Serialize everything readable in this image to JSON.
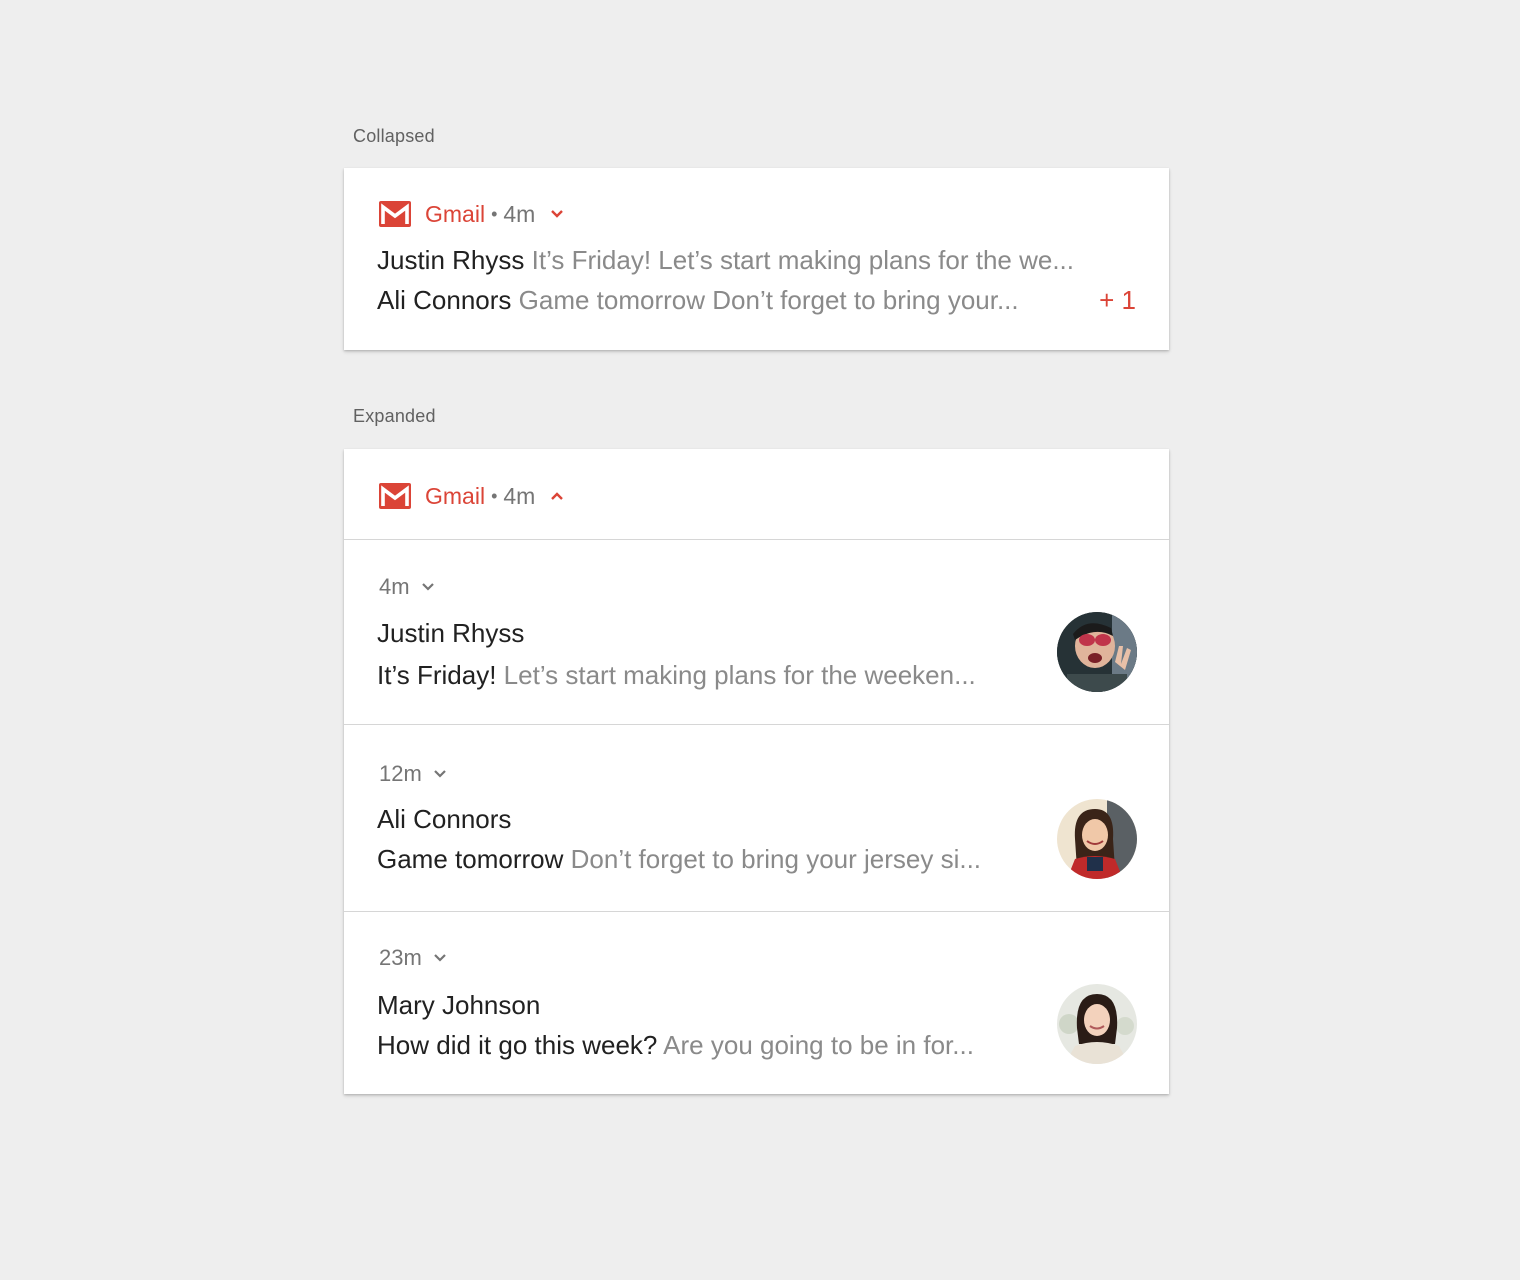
{
  "collapsed": {
    "section_label": "Collapsed",
    "app_name": "Gmail",
    "separator": "•",
    "time": "4m",
    "messages": [
      {
        "sender": "Justin Rhyss",
        "snippet": "It’s Friday! Let’s start making plans for the we..."
      },
      {
        "sender": "Ali Connors",
        "snippet": "Game tomorrow Don’t forget to bring your..."
      }
    ],
    "more_count": "+ 1"
  },
  "expanded": {
    "section_label": "Expanded",
    "app_name": "Gmail",
    "separator": "•",
    "time": "4m",
    "items": [
      {
        "time": "4m",
        "sender": "Justin Rhyss",
        "subject": "It’s Friday!",
        "preview": "Let’s start making plans for the weeken...",
        "avatar": "justin-rhyss-avatar"
      },
      {
        "time": "12m",
        "sender": "Ali Connors",
        "subject": "Game tomorrow",
        "preview": "Don’t forget to bring your jersey si...",
        "avatar": "ali-connors-avatar"
      },
      {
        "time": "23m",
        "sender": "Mary Johnson",
        "subject": "How did it go this week?",
        "preview": "Are you going to be in for...",
        "avatar": "mary-johnson-avatar"
      }
    ]
  },
  "colors": {
    "accent": "#db4437",
    "background": "#eeeeee",
    "card": "#ffffff",
    "primary_text": "#212121",
    "secondary_text": "#8a8a8a"
  },
  "icons": [
    "gmail-icon",
    "chevron-down-icon",
    "chevron-up-icon"
  ]
}
